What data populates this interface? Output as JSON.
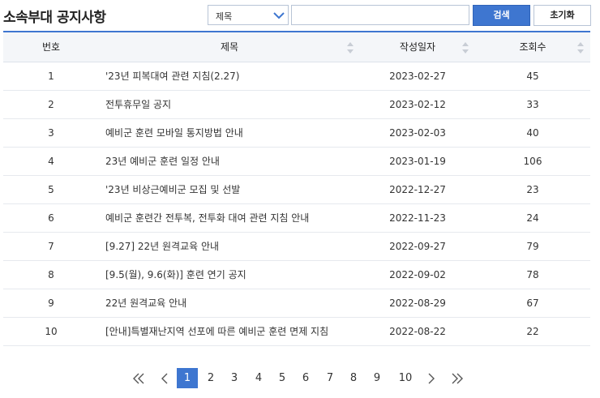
{
  "page_title": "소속부대 공지사항",
  "search": {
    "select_value": "제목",
    "input_value": "",
    "search_label": "검색",
    "reset_label": "초기화"
  },
  "table": {
    "headers": {
      "no": "번호",
      "title": "제목",
      "date": "작성일자",
      "views": "조회수"
    },
    "rows": [
      {
        "no": "1",
        "title": "'23년 피복대여 관련 지침(2.27)",
        "date": "2023-02-27",
        "views": "45"
      },
      {
        "no": "2",
        "title": "전투휴무일 공지",
        "date": "2023-02-12",
        "views": "33"
      },
      {
        "no": "3",
        "title": "예비군 훈련 모바일 통지방법 안내",
        "date": "2023-02-03",
        "views": "40"
      },
      {
        "no": "4",
        "title": "23년 예비군 훈련 일정 안내",
        "date": "2023-01-19",
        "views": "106"
      },
      {
        "no": "5",
        "title": "'23년 비상근예비군 모집 및 선발",
        "date": "2022-12-27",
        "views": "23"
      },
      {
        "no": "6",
        "title": "예비군 훈련간 전투복, 전투화 대여 관련 지침 안내",
        "date": "2022-11-23",
        "views": "24"
      },
      {
        "no": "7",
        "title": "[9.27] 22년 원격교육 안내",
        "date": "2022-09-27",
        "views": "79"
      },
      {
        "no": "8",
        "title": "[9.5(월), 9.6(화)] 훈련 연기 공지",
        "date": "2022-09-02",
        "views": "78"
      },
      {
        "no": "9",
        "title": "22년 원격교육 안내",
        "date": "2022-08-29",
        "views": "67"
      },
      {
        "no": "10",
        "title": "[안내]특별재난지역 선포에 따른 예비군 훈련 면제 지침",
        "date": "2022-08-22",
        "views": "22"
      }
    ]
  },
  "pagination": {
    "pages": [
      "1",
      "2",
      "3",
      "4",
      "5",
      "6",
      "7",
      "8",
      "9",
      "10"
    ],
    "current": "1",
    "first_icon": "double-chevron-left-icon",
    "prev_icon": "chevron-left-icon",
    "next_icon": "chevron-right-icon",
    "last_icon": "double-chevron-right-icon"
  },
  "colors": {
    "accent": "#3e76d0",
    "header_bg": "#f4f6f9",
    "border": "#b8c4d6"
  }
}
